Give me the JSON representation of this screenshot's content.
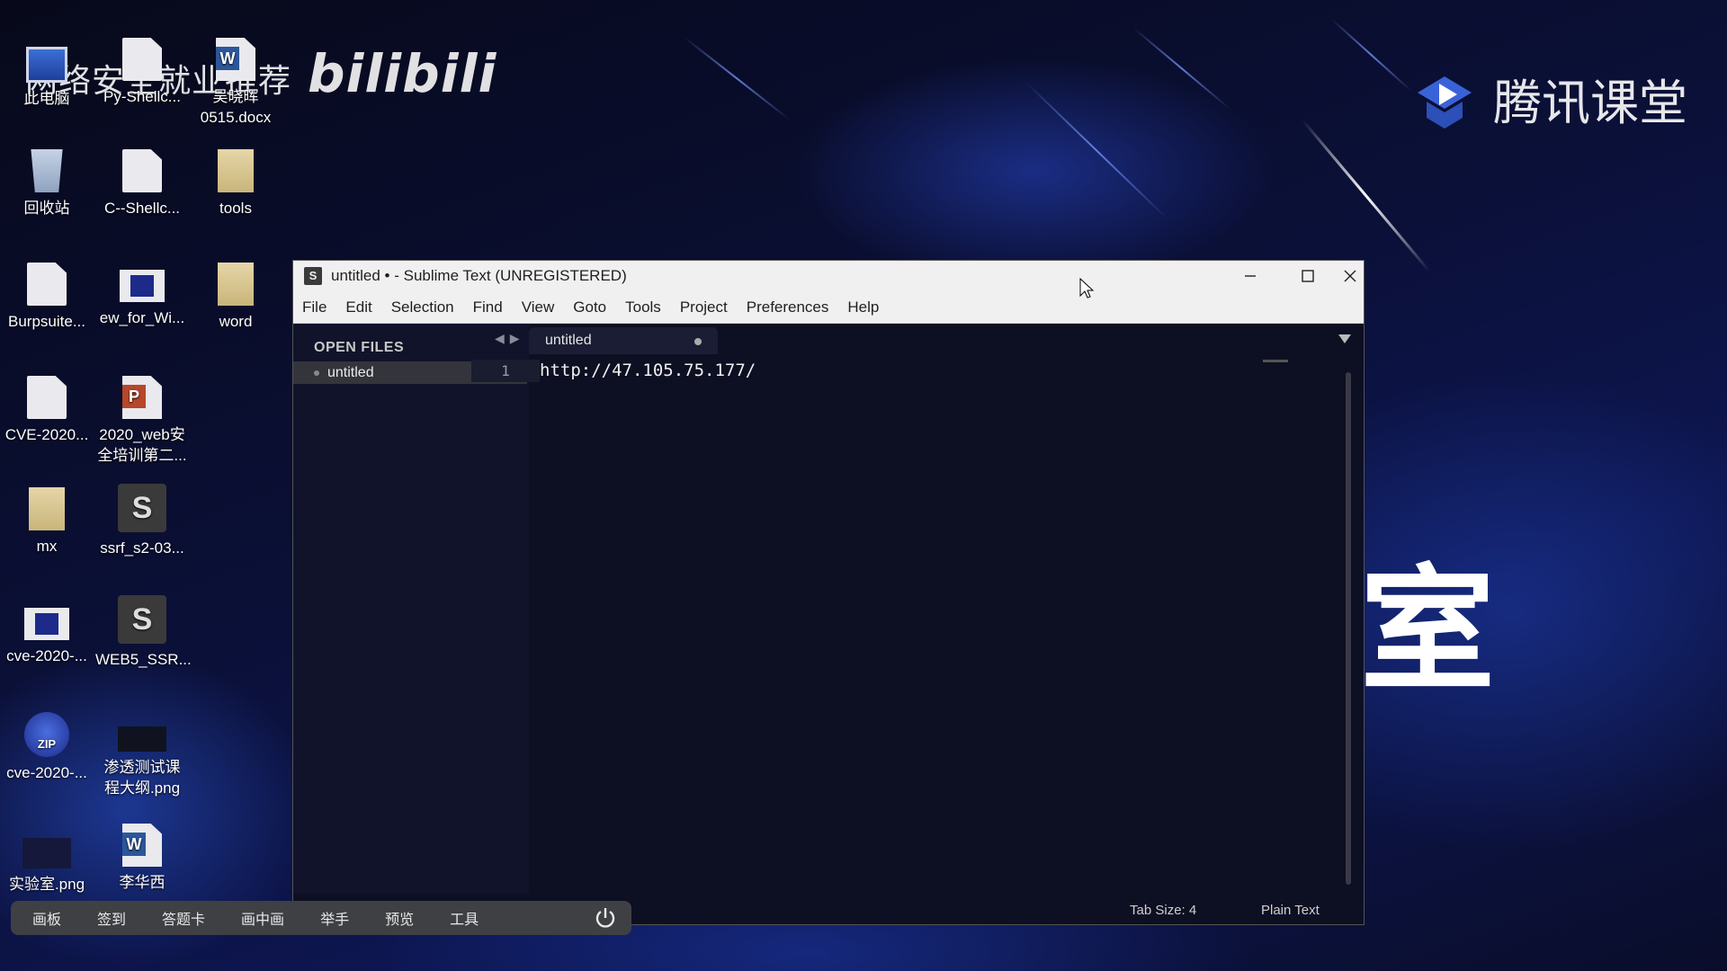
{
  "watermark": {
    "top_left": "网络安全就业推荐",
    "bilibili": "bilibili",
    "tencent_classroom": "腾讯课堂",
    "big_glyph": "室"
  },
  "desktop_icons": [
    {
      "label": "此电脑",
      "icon": "pc-icon"
    },
    {
      "label": "Py-Shellc...",
      "icon": "file-icon"
    },
    {
      "label": "吴晓晖\n0515.docx",
      "icon": "word-doc-icon"
    },
    {
      "label": "回收站",
      "icon": "recycle-bin-icon"
    },
    {
      "label": "C--Shellc...",
      "icon": "file-icon"
    },
    {
      "label": "tools",
      "icon": "folder-icon"
    },
    {
      "label": "Burpsuite...",
      "icon": "file-icon"
    },
    {
      "label": "ew_for_Wi...",
      "icon": "blue-image-icon"
    },
    {
      "label": "word",
      "icon": "folder-icon"
    },
    {
      "label": "CVE-2020...",
      "icon": "file-icon"
    },
    {
      "label": "2020_web安\n全培训第二...",
      "icon": "ppt-icon"
    },
    {
      "label": "mx",
      "icon": "folder-icon"
    },
    {
      "label": "ssrf_s2-03...",
      "icon": "sublime-file-icon"
    },
    {
      "label": "cve-2020-...",
      "icon": "blue-image-icon"
    },
    {
      "label": "WEB5_SSR...",
      "icon": "sublime-file-icon"
    },
    {
      "label": "cve-2020-...",
      "icon": "zip-icon"
    },
    {
      "label": "渗透测试课\n程大纲.png",
      "icon": "image-icon"
    },
    {
      "label": "实验室.png",
      "icon": "image-icon"
    },
    {
      "label": "李华西",
      "icon": "word-doc-icon"
    }
  ],
  "sublime": {
    "title": "untitled • - Sublime Text (UNREGISTERED)",
    "app_icon_glyph": "S",
    "menu": [
      "File",
      "Edit",
      "Selection",
      "Find",
      "View",
      "Goto",
      "Tools",
      "Project",
      "Preferences",
      "Help"
    ],
    "sidebar": {
      "header": "OPEN FILES",
      "files": [
        "untitled"
      ]
    },
    "tab": {
      "label": "untitled",
      "dirty": true
    },
    "editor": {
      "line_number": "1",
      "line_text": "http://47.105.75.177/"
    },
    "status": {
      "tab_size": "Tab Size: 4",
      "syntax": "Plain Text"
    }
  },
  "classroom_toolbar": {
    "buttons": [
      "画板",
      "签到",
      "答题卡",
      "画中画",
      "举手",
      "预览",
      "工具"
    ]
  },
  "colors": {
    "desktop_bg": "#0a0d2a",
    "editor_bg": "#0d0f22",
    "titlebar_bg": "#f0f0f0",
    "toolbar_bg": "#3f4044"
  }
}
